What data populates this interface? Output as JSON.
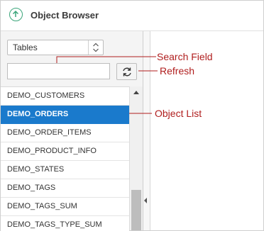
{
  "header": {
    "title": "Object Browser",
    "up_icon": "arrow-up-circle-icon",
    "accent": "#3aa57a"
  },
  "object_type": {
    "selected": "Tables"
  },
  "search": {
    "value": "",
    "placeholder": ""
  },
  "refresh": {
    "icon": "refresh-icon"
  },
  "objects": {
    "items": [
      "DEMO_CUSTOMERS",
      "DEMO_ORDERS",
      "DEMO_ORDER_ITEMS",
      "DEMO_PRODUCT_INFO",
      "DEMO_STATES",
      "DEMO_TAGS",
      "DEMO_TAGS_SUM",
      "DEMO_TAGS_TYPE_SUM"
    ],
    "selected": "DEMO_ORDERS",
    "selected_color": "#1a7acc"
  },
  "callouts": {
    "search_field": "Search Field",
    "refresh": "Refresh",
    "object_list": "Object List",
    "color": "#b01e1e"
  }
}
